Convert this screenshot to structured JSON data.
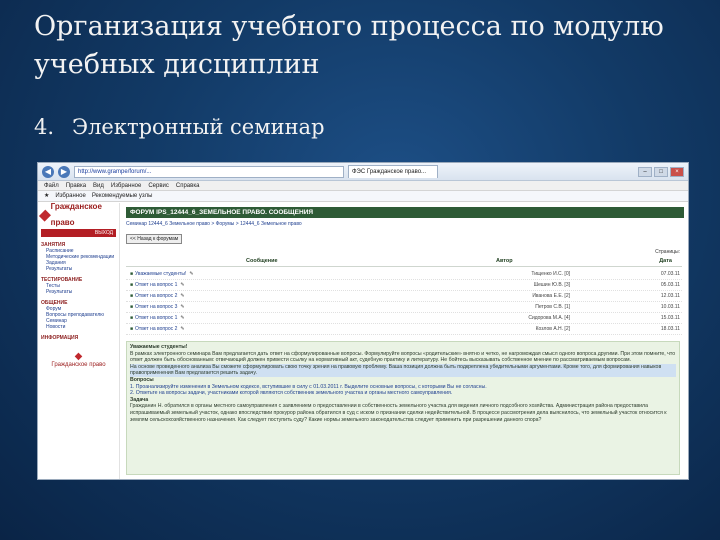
{
  "slide": {
    "title": "Организация учебного процесса по модулю учебных дисциплин",
    "bullet_number": "4.",
    "bullet_text": "Электронный семинар"
  },
  "browser": {
    "url": "http://www.grampe/forum/...",
    "tab_label": "ФЭС Гражданское право...",
    "menu": [
      "Файл",
      "Правка",
      "Вид",
      "Избранное",
      "Сервис",
      "Справка"
    ],
    "favorites": [
      "Избранное",
      "Рекомендуемые узлы"
    ]
  },
  "site": {
    "logo": "Гражданское право",
    "exit_label": "ВЫХОД",
    "menu_groups": [
      {
        "head": "ЗАНЯТИЯ",
        "items": [
          "Расписание",
          "Методические рекомендации",
          "Задания",
          "Результаты"
        ]
      },
      {
        "head": "ТЕСТИРОВАНИЕ",
        "items": [
          "Тесты",
          "Результаты"
        ]
      },
      {
        "head": "ОБЩЕНИЕ",
        "items": [
          "Форум",
          "Вопросы преподавателю",
          "Семинар",
          "Новости"
        ]
      },
      {
        "head": "ИНФОРМАЦИЯ",
        "items": []
      }
    ],
    "bottom_logo": "Гражданское право"
  },
  "forum": {
    "header": "ФОРУМ IPS_12444_6_ЗЕМЕЛЬНОЕ ПРАВО. СООБЩЕНИЯ",
    "breadcrumbs": "Семинар 12444_6 Земельное право > Форумы > 12444_6 Земельное право",
    "back_button": "<< Назад к форумам",
    "pages_label": "Страницы:",
    "columns": {
      "subject": "Сообщение",
      "author": "Автор",
      "date": "Дата"
    },
    "rows": [
      {
        "subject": "Уважаемые студенты!",
        "author": "Тищенко И.С. [0]",
        "date": "07.03.11"
      },
      {
        "subject": "Ответ на вопрос 1",
        "author": "Шешин Ю.В. [3]",
        "date": "05.03.11"
      },
      {
        "subject": "Ответ на вопрос 2",
        "author": "Иванова Е.Е. [2]",
        "date": "12.03.11"
      },
      {
        "subject": "Ответ на вопрос 3",
        "author": "Петров С.В. [1]",
        "date": "10.03.11"
      },
      {
        "subject": "Ответ на вопрос 1",
        "author": "Сидорова М.А. [4]",
        "date": "15.03.11"
      },
      {
        "subject": "Ответ на вопрос 2",
        "author": "Козлов А.Н. [2]",
        "date": "18.03.11"
      }
    ],
    "post": {
      "greeting": "Уважаемые студенты!",
      "paragraph1": "В рамках электронного семинара Вам предлагается дать ответ на сформулированные вопросы. Формулируйте вопросы «родительские» внятно и четко, не нагромождая смысл одного вопроса другими. При этом помните, что ответ должен быть обоснованным: отвечающий должен привести ссылку на нормативный акт, судебную практику и литературу. Не бойтесь высказывать собственное мнение по рассматриваемым вопросам.",
      "paragraph2": "На основе проведенного анализа Вы сможете сформулировать свою точку зрения на правовую проблему. Ваша позиция должна быть подкреплена убедительными аргументами. Кроме того, для формирования навыков правоприменения Вам предлагается решить задачу.",
      "questions_label": "Вопросы",
      "question1": "1. Проанализируйте изменения в Земельном кодексе, вступившие в силу с 01.03.2011 г. Выделите основные вопросы, с которыми Вы не согласны.",
      "question2": "2. Ответьте на вопросы задачи, участниками которой являются собственник земельного участка и органы местного самоуправления.",
      "task_label": "Задача",
      "task_text": "Гражданин Н. обратился в органы местного самоуправления с заявлением о предоставлении в собственность земельного участка для ведения личного подсобного хозяйства. Администрация района предоставила испрашиваемый земельный участок, однако впоследствии прокурор района обратился в суд с иском о признании сделки недействительной. В процессе рассмотрения дела выяснилось, что земельный участок относится к землям сельскохозяйственного назначения. Как следует поступить суду? Какие нормы земельного законодательства следует применить при разрешении данного спора?"
    }
  }
}
